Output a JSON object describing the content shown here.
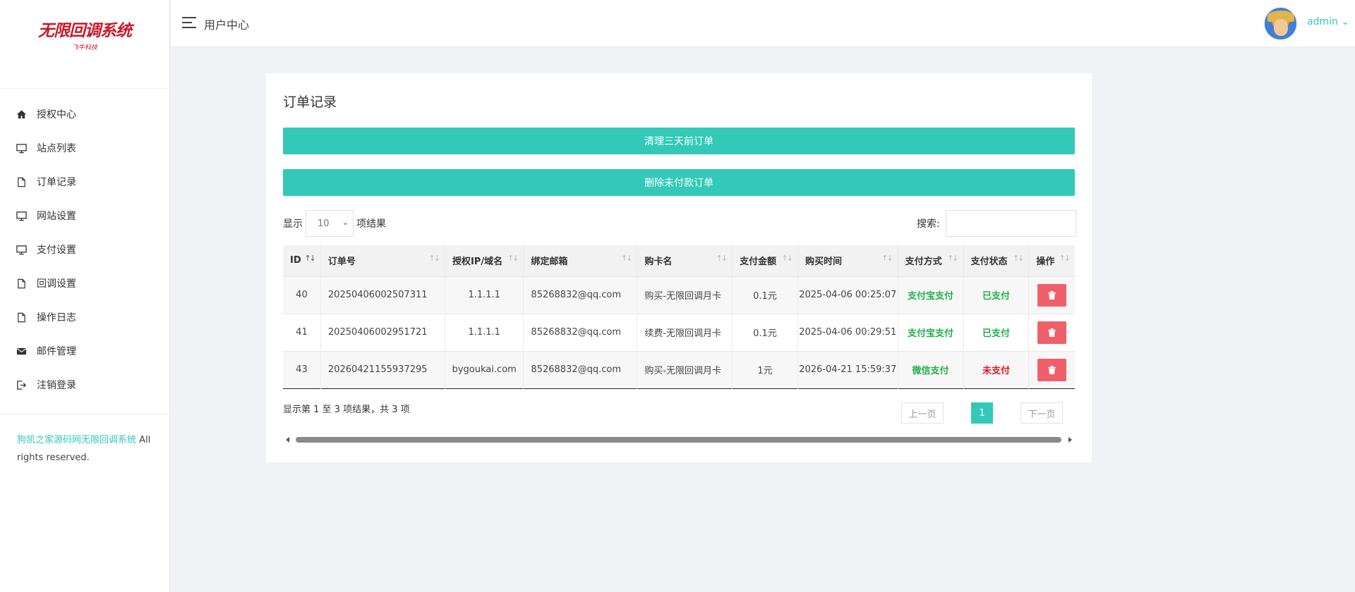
{
  "logo": {
    "title": "无限回调系统",
    "subtitle": "飞牛科技"
  },
  "sidebar": {
    "items": [
      {
        "label": "授权中心",
        "icon": "home-icon"
      },
      {
        "label": "站点列表",
        "icon": "monitor-icon"
      },
      {
        "label": "订单记录",
        "icon": "file-icon"
      },
      {
        "label": "网站设置",
        "icon": "monitor-icon"
      },
      {
        "label": "支付设置",
        "icon": "monitor-icon"
      },
      {
        "label": "回调设置",
        "icon": "file-icon"
      },
      {
        "label": "操作日志",
        "icon": "file-icon"
      },
      {
        "label": "邮件管理",
        "icon": "mail-icon"
      },
      {
        "label": "注销登录",
        "icon": "logout-icon"
      }
    ],
    "copyright_link": "狗凯之家源码网无限回调系统",
    "copyright_text": " All rights reserved."
  },
  "header": {
    "title": "用户中心",
    "user": "admin"
  },
  "card": {
    "title": "订单记录",
    "btn_clear": "清理三天前订单",
    "btn_delete_unpaid": "删除未付款订单",
    "length_prefix": "显示",
    "length_value": "10",
    "length_suffix": "项结果",
    "search_label": "搜索:",
    "search_value": ""
  },
  "table": {
    "columns": [
      "ID",
      "订单号",
      "授权IP/域名",
      "绑定邮箱",
      "购卡名",
      "支付金额",
      "购买时间",
      "支付方式",
      "支付状态",
      "操作"
    ],
    "rows": [
      {
        "id": "40",
        "order_no": "20250406002507311",
        "domain": "1.1.1.1",
        "email": "85268832@qq.com",
        "card": "购买-无限回调月卡",
        "amount": "0.1元",
        "time": "2025-04-06 00:25:07",
        "pay_method": "支付宝支付",
        "status": "已支付",
        "status_color": "#21b04b"
      },
      {
        "id": "41",
        "order_no": "20250406002951721",
        "domain": "1.1.1.1",
        "email": "85268832@qq.com",
        "card": "续费-无限回调月卡",
        "amount": "0.1元",
        "time": "2025-04-06 00:29:51",
        "pay_method": "支付宝支付",
        "status": "已支付",
        "status_color": "#21b04b"
      },
      {
        "id": "43",
        "order_no": "20260421155937295",
        "domain": "bygoukai.com",
        "email": "85268832@qq.com",
        "card": "购买-无限回调月卡",
        "amount": "1元",
        "time": "2026-04-21 15:59:37",
        "pay_method": "微信支付",
        "status": "未支付",
        "status_color": "#e0141e"
      }
    ]
  },
  "footer": {
    "info": "显示第 1 至 3 项结果，共 3 项",
    "prev": "上一页",
    "current_page": "1",
    "next": "下一页"
  },
  "colors": {
    "accent": "#33c9b8",
    "danger": "#f0606a",
    "paid": "#21b04b",
    "unpaid": "#e0141e"
  }
}
